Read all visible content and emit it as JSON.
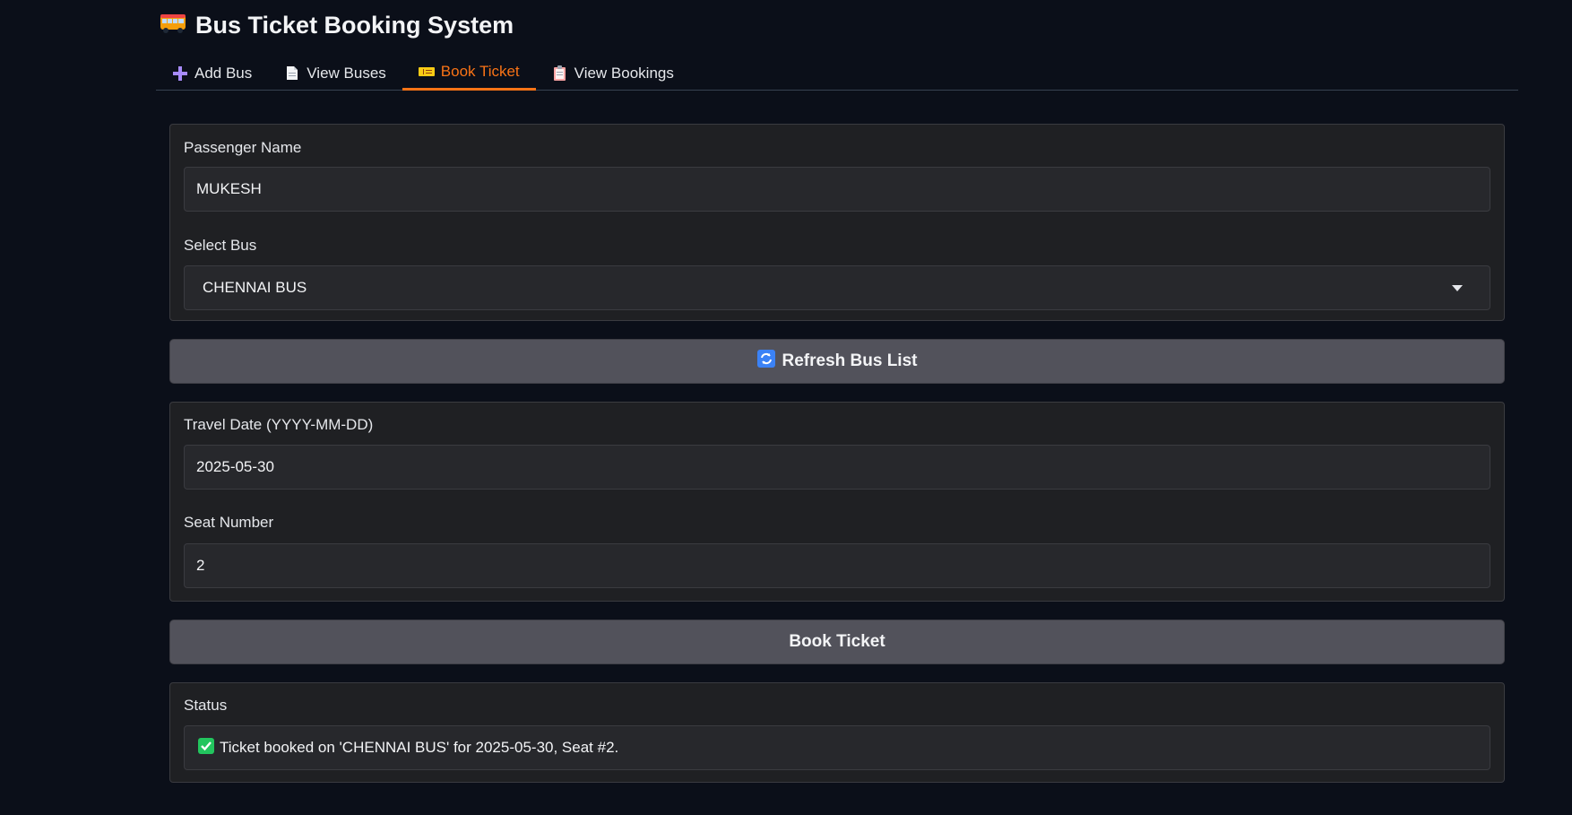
{
  "app": {
    "title": "Bus Ticket Booking System",
    "title_icon": "bus-icon"
  },
  "tabs": [
    {
      "label": "Add Bus",
      "icon": "plus-icon",
      "active": false
    },
    {
      "label": "View Buses",
      "icon": "document-icon",
      "active": false
    },
    {
      "label": "Book Ticket",
      "icon": "ticket-icon",
      "active": true
    },
    {
      "label": "View Bookings",
      "icon": "clipboard-icon",
      "active": false
    }
  ],
  "form": {
    "passenger_name": {
      "label": "Passenger Name",
      "value": "MUKESH"
    },
    "select_bus": {
      "label": "Select Bus",
      "value": "CHENNAI BUS"
    },
    "refresh_button": {
      "label": "Refresh Bus List",
      "icon": "refresh-icon"
    },
    "travel_date": {
      "label": "Travel Date (YYYY-MM-DD)",
      "value": "2025-05-30"
    },
    "seat_number": {
      "label": "Seat Number",
      "value": "2"
    },
    "book_button": {
      "label": "Book Ticket"
    },
    "status": {
      "label": "Status",
      "value": "Ticket booked on 'CHENNAI BUS' for 2025-05-30, Seat #2.",
      "icon": "checkmark-icon"
    }
  },
  "colors": {
    "accent": "#f97316",
    "background": "#0b0f19",
    "panel": "#1f2023",
    "button": "#52525b"
  }
}
